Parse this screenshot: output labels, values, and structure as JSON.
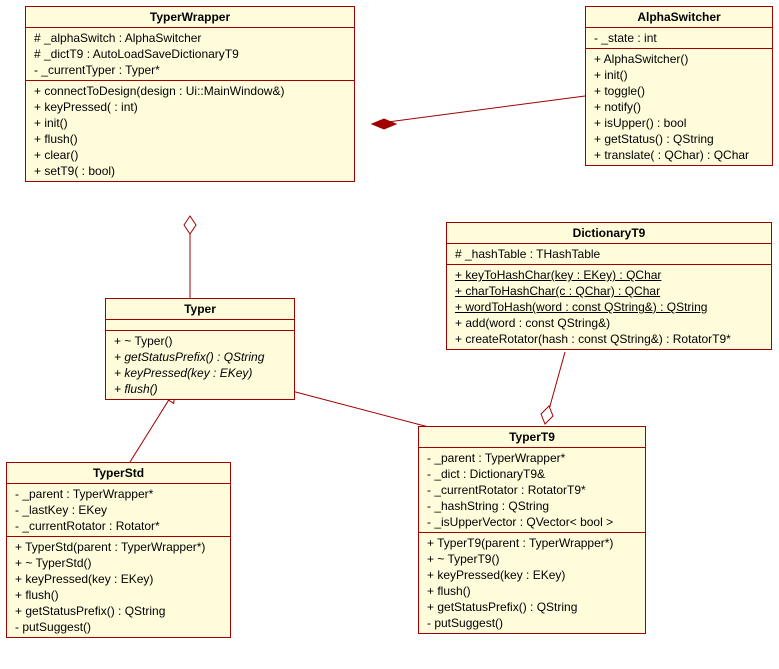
{
  "classes": {
    "TyperWrapper": {
      "title": "TyperWrapper",
      "attrs": [
        "# _alphaSwitch : AlphaSwitcher",
        "# _dictT9 : AutoLoadSaveDictionaryT9",
        "- _currentTyper : Typer*"
      ],
      "ops": [
        "+ connectToDesign(design : Ui::MainWindow&)",
        "+ keyPressed( : int)",
        "+ init()",
        "+ flush()",
        "+ clear()",
        "+ setT9( : bool)"
      ]
    },
    "AlphaSwitcher": {
      "title": "AlphaSwitcher",
      "attrs": [
        "- _state : int"
      ],
      "ops": [
        "+ AlphaSwitcher()",
        "+ init()",
        "+ toggle()",
        "+ notify()",
        "+ isUpper() : bool",
        "+ getStatus() : QString",
        "+ translate( : QChar) : QChar"
      ]
    },
    "Typer": {
      "title": "Typer",
      "attrs": [],
      "ops": [
        {
          "t": "+ ~ Typer()",
          "i": false
        },
        {
          "t": "+ getStatusPrefix() : QString",
          "i": true
        },
        {
          "t": "+ keyPressed(key : EKey)",
          "i": true
        },
        {
          "t": "+ flush()",
          "i": true
        }
      ]
    },
    "DictionaryT9": {
      "title": "DictionaryT9",
      "attrs": [
        "# _hashTable : THashTable"
      ],
      "ops": [
        {
          "t": "+ keyToHashChar(key : EKey) : QChar",
          "u": true
        },
        {
          "t": "+ charToHashChar(c : QChar) : QChar",
          "u": true
        },
        {
          "t": "+ wordToHash(word : const QString&) : QString",
          "u": true
        },
        {
          "t": "+ add(word : const QString&)",
          "u": false
        },
        {
          "t": "+ createRotator(hash : const QString&) : RotatorT9*",
          "u": false
        }
      ]
    },
    "TyperStd": {
      "title": "TyperStd",
      "attrs": [
        "- _parent : TyperWrapper*",
        "- _lastKey : EKey",
        "- _currentRotator : Rotator*"
      ],
      "ops": [
        "+ TyperStd(parent : TyperWrapper*)",
        "+ ~ TyperStd()",
        "+ keyPressed(key : EKey)",
        "+ flush()",
        "+ getStatusPrefix() : QString",
        "- putSuggest()"
      ]
    },
    "TyperT9": {
      "title": "TyperT9",
      "attrs": [
        "- _parent : TyperWrapper*",
        "- _dict : DictionaryT9&",
        "- _currentRotator : RotatorT9*",
        "- _hashString : QString",
        "- _isUpperVector : QVector< bool >"
      ],
      "ops": [
        "+ TyperT9(parent : TyperWrapper*)",
        "+ ~ TyperT9()",
        "+ keyPressed(key : EKey)",
        "+ flush()",
        "+ getStatusPrefix() : QString",
        "- putSuggest()"
      ]
    }
  }
}
